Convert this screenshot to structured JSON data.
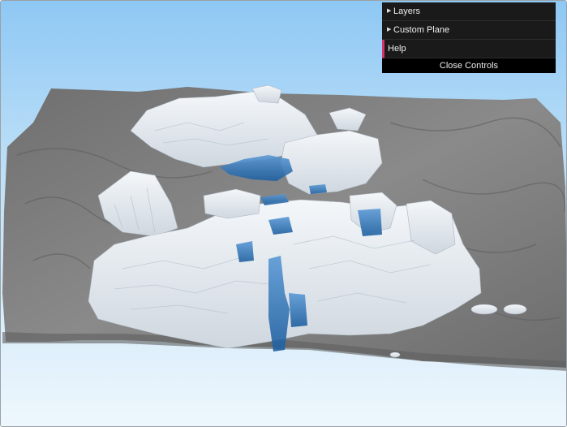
{
  "controls": {
    "items": [
      {
        "label": "Layers",
        "expandable": true
      },
      {
        "label": "Custom Plane",
        "expandable": true
      },
      {
        "label": "Help",
        "expandable": false
      }
    ],
    "close_label": "Close Controls"
  },
  "colors": {
    "sky_top": "#8ec8f4",
    "sky_bottom": "#eaf5fd",
    "terrain": "#7a7a7a",
    "buildings": "#e9eef3",
    "water_highlight": "#2a6fb6",
    "help_accent": "#d6336c"
  },
  "icons": {
    "expand": "triangle-right-icon"
  }
}
